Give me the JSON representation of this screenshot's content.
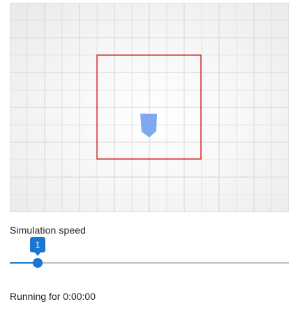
{
  "simulation": {
    "grid_color": "#d4d4d4",
    "boundary_color": "#d32f2f",
    "agent_color": "#7fa8f2"
  },
  "controls": {
    "speed_label": "Simulation speed",
    "speed_value": "1",
    "speed_fraction": 0.1,
    "accent_color": "#1976d2"
  },
  "status": {
    "running_text": "Running for 0:00:00"
  }
}
